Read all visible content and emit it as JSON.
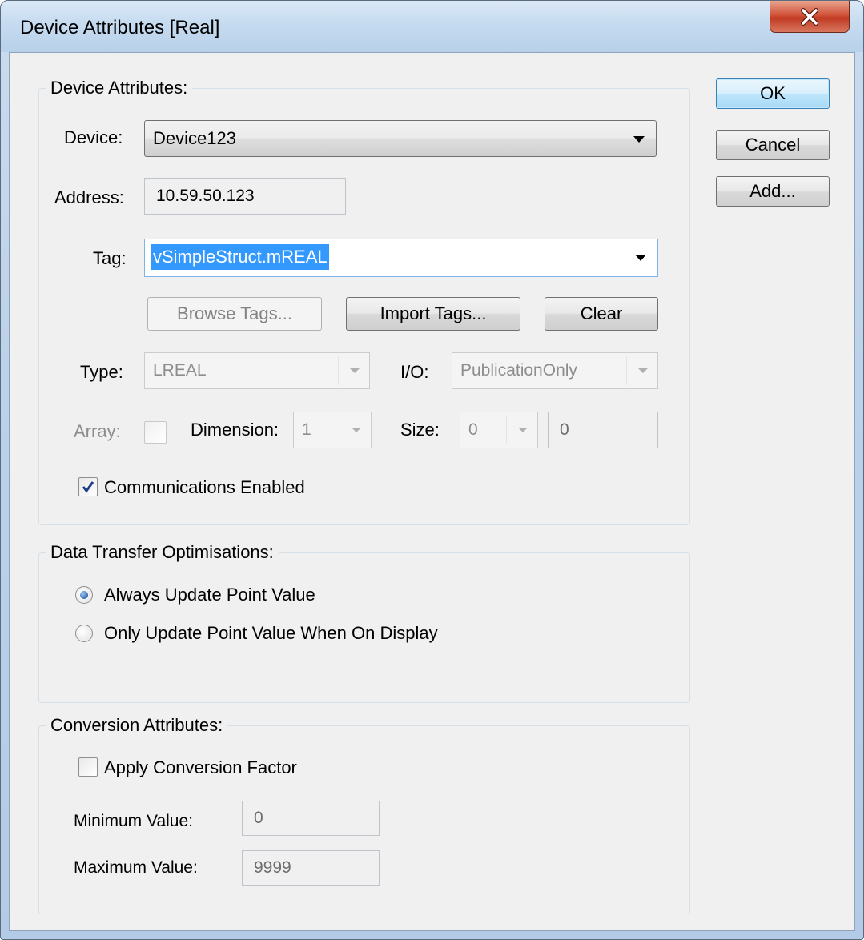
{
  "window": {
    "title": "Device Attributes  [Real]",
    "close_icon": "close-icon"
  },
  "buttons": {
    "ok": "OK",
    "cancel": "Cancel",
    "add": "Add..."
  },
  "device_attributes": {
    "group_label": "Device Attributes:",
    "device_label": "Device:",
    "device_value": "Device123",
    "address_label": "Address:",
    "address_value": "10.59.50.123",
    "tag_label": "Tag:",
    "tag_value": "vSimpleStruct.mREAL",
    "browse_tags": "Browse Tags...",
    "import_tags": "Import Tags...",
    "clear": "Clear",
    "type_label": "Type:",
    "type_value": "LREAL",
    "io_label": "I/O:",
    "io_value": "PublicationOnly",
    "array_label": "Array:",
    "array_checked": false,
    "dimension_label": "Dimension:",
    "dimension_value": "1",
    "size_label": "Size:",
    "size_value": "0",
    "size_field_value": "0",
    "comms_label": "Communications Enabled",
    "comms_checked": true
  },
  "data_transfer": {
    "group_label": "Data Transfer Optimisations:",
    "option_always": "Always Update Point Value",
    "option_display": "Only Update Point Value When On Display",
    "selected": "always"
  },
  "conversion": {
    "group_label": "Conversion Attributes:",
    "apply_label": "Apply Conversion Factor",
    "apply_checked": false,
    "min_label": "Minimum Value:",
    "min_value": "0",
    "max_label": "Maximum Value:",
    "max_value": "9999"
  },
  "colors": {
    "selection": "#3399ff",
    "dialog_bg": "#f0f0f0",
    "close_button": "#c8472f"
  }
}
